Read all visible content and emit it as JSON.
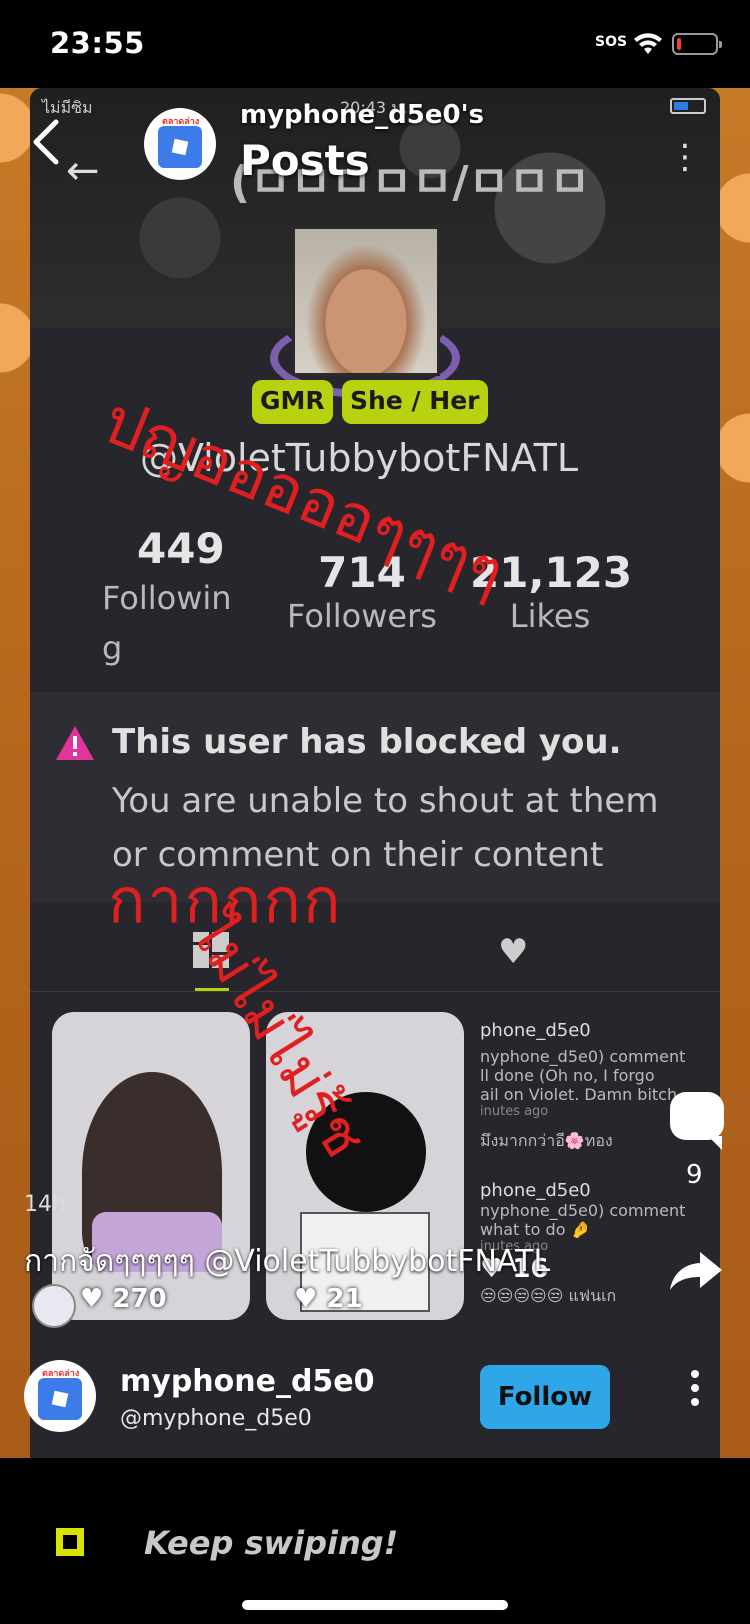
{
  "status_bar": {
    "time": "23:55",
    "sos": "SOS"
  },
  "inner_screen": {
    "carrier": "ไม่มีซิม",
    "time": "20:43 น.",
    "title_fragment": "(ㅁㅁㅁㅁㅁ/ㅁㅁㅁ",
    "tags": [
      "GMR",
      "She / Her"
    ],
    "username": "@VioletTubbybotFNATL",
    "stats": {
      "following_value": "449",
      "following_label": "Followin\ng",
      "followers_value": "714",
      "followers_label": "Followers",
      "likes_value": "21,123",
      "likes_label": "Likes"
    },
    "blocked_title": "This user has blocked you.",
    "blocked_desc": "You are unable to shout at them or comment on their content",
    "posts": [
      {
        "likes": "270"
      },
      {
        "likes": "21"
      }
    ],
    "feed": {
      "line1": "phone_d5e0",
      "line2": "nyphone_d5e0) comment",
      "line3": "ll done (Oh no, I forgo",
      "line4": "ail on Violet. Damn bitch..",
      "line5": "inutes ago",
      "line6": "มึงมากกว่าอี🌸ทอง",
      "line7": "phone_d5e0",
      "line8": "nyphone_d5e0) comment",
      "line9": " what to do 🤌",
      "line10": "inutes ago",
      "likes": "16",
      "line11": "😒😒😒😒😒 แฟนเก"
    }
  },
  "annotations": {
    "red_1": "ปญอออออๆๆๆๆ",
    "red_2": "กากกกก",
    "red_3": "ไม่ไม่ไม่รู้ช"
  },
  "overlay": {
    "avatar_badge": "ตลาดล่าง",
    "username": "myphone_d5e0's",
    "title": "Posts",
    "comment_count": "9",
    "time_ago": "14h",
    "caption": "กากจัดๆๆๆๆๆ @VioletTubbybotFNATL"
  },
  "author": {
    "avatar_badge": "ตลาดล่าง",
    "name": "myphone_d5e0",
    "handle": "@myphone_d5e0",
    "follow_label": "Follow"
  },
  "bottom": {
    "keep_swiping": "Keep swiping!"
  },
  "colors": {
    "accent_green": "#b8d20f",
    "follow_blue": "#2fa6e8",
    "annotation_red": "#e02020",
    "warning_pink": "#e0359a"
  }
}
